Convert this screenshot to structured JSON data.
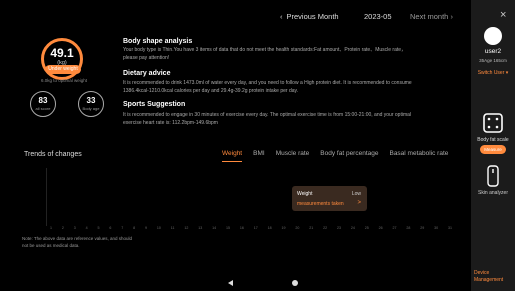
{
  "header": {
    "prev_label": "Previous Month",
    "month": "2023-05",
    "next_label": "Next month"
  },
  "score": {
    "weight_value": "49.1",
    "weight_unit": "(kg)",
    "status_badge": "Under weight",
    "hint": "6.0kg to optimal weight",
    "score_value": "83",
    "score_label": "all score",
    "age_value": "33",
    "age_label": "Body age"
  },
  "analysis": {
    "s1_title": "Body shape analysis",
    "s1_body": "Your body type is Thin.You have 3 items of data that do not meet the health standards:Fat amount、Protein rate、Muscle rate， please pay attention!",
    "s2_title": "Dietary advice",
    "s2_body": "It is recommended to drink 1473.0ml of water every day, and you need to follow a High protein diet. It is recommended to consume 1386.4kcal-1210.0kcal calories per day and 29.4g-39.2g protein intake per day.",
    "s3_title": "Sports Suggestion",
    "s3_body": "It is recommended to engage in 30 minutes of exercise every day. The optimal exercise time is from 15:00-21:00, and your optimal exercise heart rate is: 112.2bpm-149.6bpm"
  },
  "trends": {
    "title": "Trends of changes",
    "tabs": [
      "Weight",
      "BMI",
      "Muscle rate",
      "Body fat percentage",
      "Basal metabolic rate"
    ],
    "active_tab": "Weight",
    "x_labels": [
      "1",
      "2",
      "3",
      "4",
      "5",
      "6",
      "7",
      "8",
      "9",
      "10",
      "11",
      "12",
      "13",
      "14",
      "15",
      "16",
      "17",
      "18",
      "19",
      "20",
      "21",
      "22",
      "23",
      "24",
      "25",
      "26",
      "27",
      "28",
      "29",
      "30",
      "31"
    ],
    "tooltip": {
      "metric": "Weight",
      "level": "Low",
      "link": "measurements taken",
      "arrow": ">"
    },
    "note": "Note: The above data are reference values, and should not be used as medical data."
  },
  "user_panel": {
    "close": "×",
    "name": "user2",
    "meta": "35Age 165cm",
    "switch_label": "Switch User",
    "scale_label": "Body fat scale",
    "measure_button": "Measure",
    "skin_label": "Skin analyzer",
    "device_mgmt": "Device Management"
  },
  "colors": {
    "accent": "#ff8a3d",
    "background": "#000000",
    "panel": "#1b1b1b"
  }
}
